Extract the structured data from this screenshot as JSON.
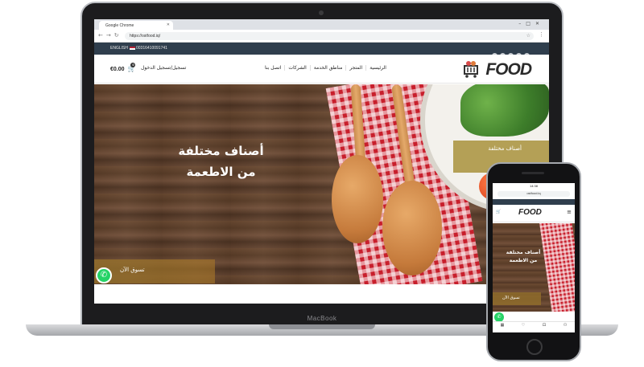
{
  "device": {
    "laptop_brand": "MacBook"
  },
  "browser": {
    "tab_title": "Google Chrome",
    "url": "https://ostfood.iq/",
    "window_controls": [
      "–",
      "□",
      "✕"
    ]
  },
  "site": {
    "topbar": {
      "language": "ENGLISH",
      "phone": "00316410091741",
      "socials": [
        "telegram",
        "linkedin",
        "pinterest",
        "twitter",
        "facebook"
      ]
    },
    "header": {
      "cart_total": "€0.00",
      "cart_count": "0",
      "login_label": "تسجيل/تسجيل الدخول",
      "nav": [
        "الرئيسية",
        "المتجر",
        "مناطق الخدمة",
        "الشركات",
        "اتصل بنا"
      ],
      "logo_text": "FOOD"
    },
    "hero": {
      "heading_line1": "أصناف مختلفة",
      "heading_line2": "من الاطعمة",
      "promo_card": "أصناف مختلفة",
      "cta_label": "تسوق الآن"
    }
  },
  "phone": {
    "status": "14:38",
    "url": "ostfood.iq",
    "logo_text": "FOOD",
    "heading_line1": "أصناف مختلفة",
    "heading_line2": "من الاطعمة",
    "cta_label": "تسوق الآن"
  },
  "colors": {
    "topbar": "#2f3e4d",
    "accent_gold": "#a8923c",
    "whatsapp": "#25d366"
  }
}
